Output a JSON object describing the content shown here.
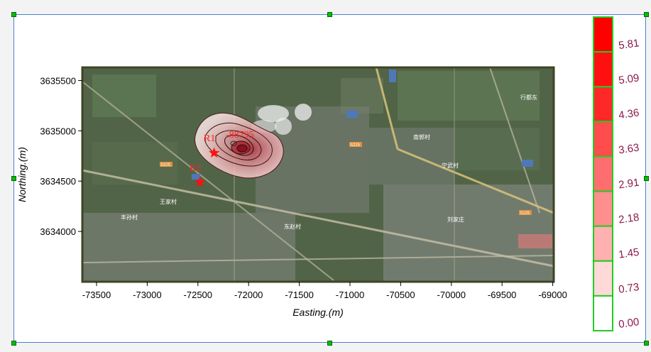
{
  "chart_data": {
    "type": "heatmap",
    "title": "",
    "xlabel": "Easting.(m)",
    "ylabel": "Northing.(m)",
    "xlim": [
      -73640,
      -68990
    ],
    "ylim": [
      3633500,
      3635630
    ],
    "x_ticks": [
      -73500,
      -73000,
      -72500,
      -72000,
      -71500,
      -71000,
      -70500,
      -70000,
      -69500,
      -69000
    ],
    "y_ticks": [
      3634000,
      3634500,
      3635000,
      3635500
    ],
    "x_tick_labels": [
      "-73500",
      "-73000",
      "-72500",
      "-72000",
      "-71500",
      "-71000",
      "-70500",
      "-70000",
      "-69500",
      "-69000"
    ],
    "y_tick_labels": [
      "3634000",
      "3634500",
      "3635000",
      "3635500"
    ],
    "plume_peak": {
      "x": -72020,
      "y": 3634810,
      "value": 5.81
    },
    "receptors": [
      {
        "name": "R1",
        "x": -72340,
        "y": 3634780
      },
      {
        "name": "R2",
        "x": -72480,
        "y": 3634490
      }
    ],
    "annotations": [
      {
        "text": "R1",
        "x": -72490,
        "y": 3634900
      },
      {
        "text": "-88795",
        "x": -72180,
        "y": 3634920
      },
      {
        "text": "R2",
        "x": -72560,
        "y": 3634600
      }
    ],
    "colorbar": {
      "labels": [
        "5.81",
        "5.09",
        "4.36",
        "3.63",
        "2.91",
        "2.18",
        "1.45",
        "0.73",
        "0.00"
      ],
      "colors": [
        "#ff0000",
        "#ff1010",
        "#ff2828",
        "#ff4c4c",
        "#ff6e6e",
        "#ff8e8e",
        "#ffb0b0",
        "#ffd8d8",
        "#ffffff"
      ],
      "border_color": "#22cc22",
      "label_color": "#8b1a4a"
    },
    "map_labels": [
      "S225",
      "S225",
      "S225",
      "南郭村",
      "宁武村",
      "行都东",
      "王家村",
      "丰孙村",
      "刘家庄",
      "东赵村"
    ]
  }
}
